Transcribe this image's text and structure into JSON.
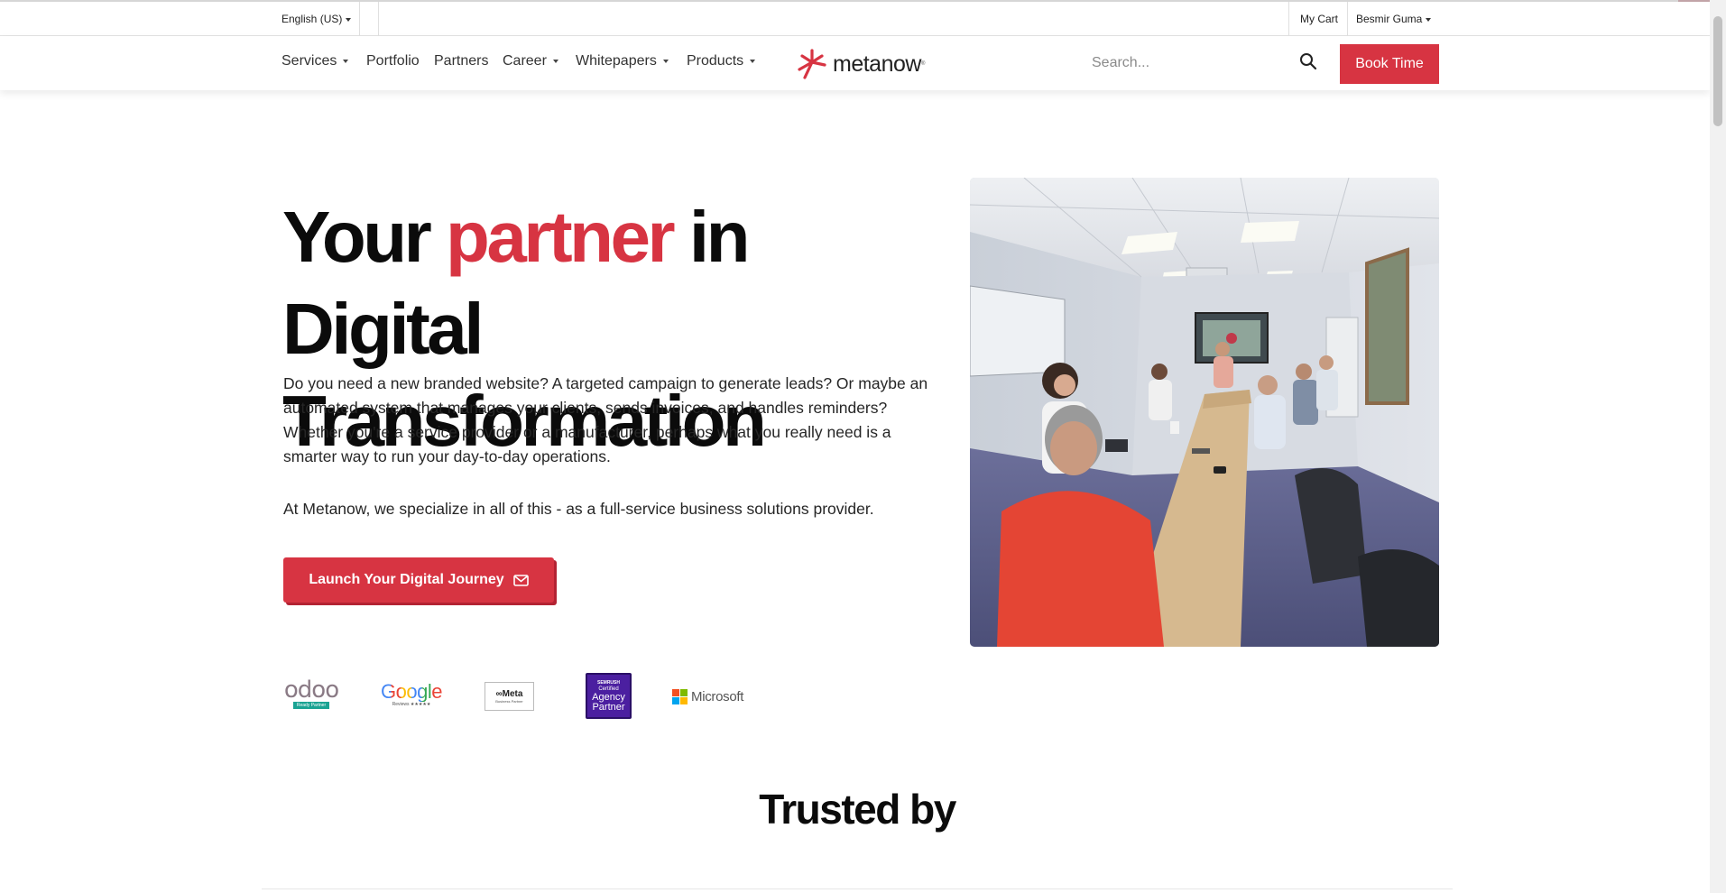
{
  "topbar": {
    "language": "English (US)",
    "my_cart": "My Cart",
    "user_name": "Besmir Guma"
  },
  "nav": {
    "items": [
      {
        "label": "Services",
        "dropdown": true
      },
      {
        "label": "Portfolio",
        "dropdown": false
      },
      {
        "label": "Partners",
        "dropdown": false
      },
      {
        "label": "Career",
        "dropdown": true
      },
      {
        "label": "Whitepapers",
        "dropdown": true
      },
      {
        "label": "Products",
        "dropdown": true
      }
    ],
    "logo_text": "metanow",
    "logo_reg": "®",
    "search_placeholder": "Search...",
    "book_label": "Book Time",
    "icons": {
      "search": "search-icon"
    }
  },
  "hero": {
    "title_part1": "Your ",
    "title_accent": "partner",
    "title_part2": " in Digital Transformation",
    "paragraph1": "Do you need a new branded website? A targeted campaign to generate leads? Or maybe an automated system that manages your clients, sends invoices, and handles reminders? Whether you're a service provider or a manufacturer, perhaps what you really need is a smarter way to run your day-to-day operations.",
    "paragraph2": "At Metanow, we specialize in all of this - as a full-service business solutions provider.",
    "cta_label": "Launch Your Digital Journey",
    "cta_icon": "envelope-icon"
  },
  "badges": {
    "odoo": {
      "name": "odoo",
      "tag": "Ready Partner"
    },
    "google": {
      "name": "Google",
      "sub": "Reviews ★★★★★"
    },
    "meta": {
      "name": "∞Meta",
      "sub": "Business Partner"
    },
    "semrush": {
      "top": "SEMRUSH",
      "cert": "Certified",
      "line1": "Agency",
      "line2": "Partner"
    },
    "microsoft": {
      "name": "Microsoft"
    }
  },
  "trusted_heading": "Trusted by",
  "colors": {
    "accent": "#d73442",
    "text": "#0b0b0b",
    "semrush_purple": "#4b1fa0",
    "odoo_teal": "#1aa393"
  }
}
